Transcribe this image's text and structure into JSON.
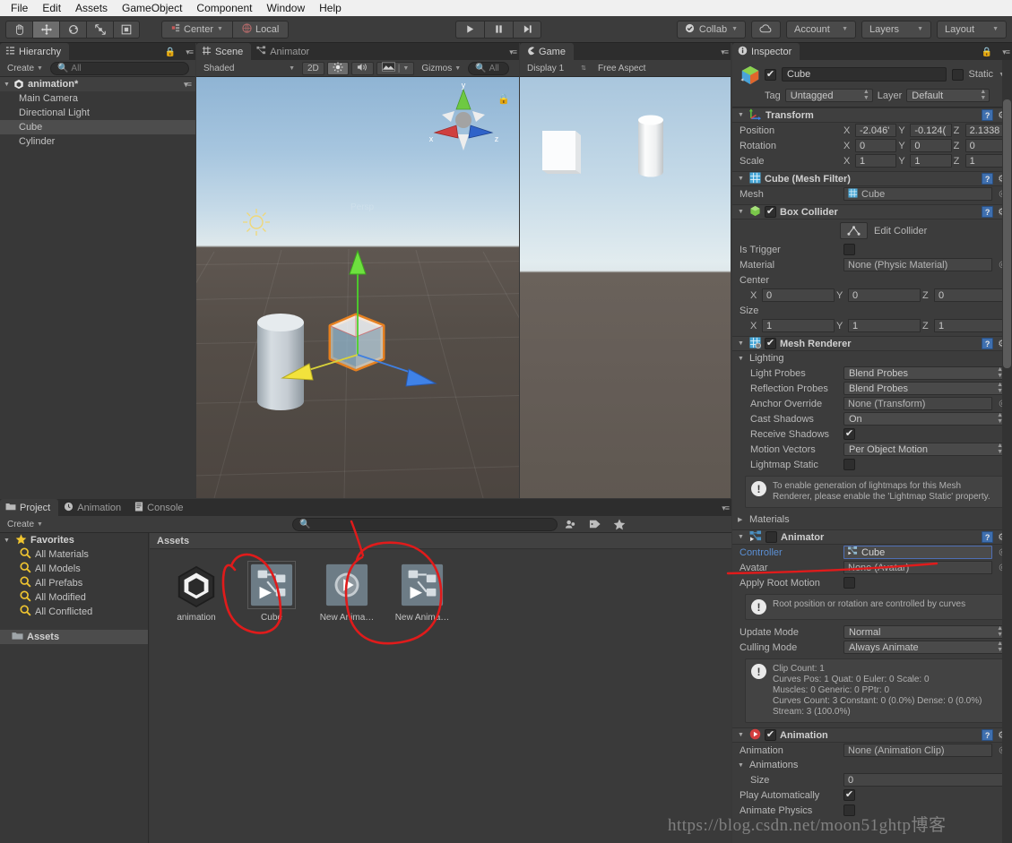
{
  "menubar": {
    "items": [
      "File",
      "Edit",
      "Assets",
      "GameObject",
      "Component",
      "Window",
      "Help"
    ]
  },
  "toolbar": {
    "transform_tools": [
      {
        "name": "hand-tool",
        "glyph": "✋",
        "active": false
      },
      {
        "name": "move-tool",
        "glyph": "✥",
        "active": true
      },
      {
        "name": "rotate-tool",
        "glyph": "↻",
        "active": false
      },
      {
        "name": "scale-tool",
        "glyph": "⤢",
        "active": false
      },
      {
        "name": "rect-tool",
        "glyph": "▣",
        "active": false
      }
    ],
    "pivot_label": "Center",
    "space_label": "Local",
    "play_label": "▶",
    "pause_label": "❚❚",
    "step_label": "▶❘",
    "collab_label": "Collab",
    "cloud_label": "☁",
    "account_label": "Account",
    "layers_label": "Layers",
    "layout_label": "Layout"
  },
  "hierarchy": {
    "tab_label": "Hierarchy",
    "create_label": "Create",
    "search_placeholder": "All",
    "scene_name": "animation*",
    "items": [
      {
        "label": "Main Camera",
        "selected": false
      },
      {
        "label": "Directional Light",
        "selected": false
      },
      {
        "label": "Cube",
        "selected": true
      },
      {
        "label": "Cylinder",
        "selected": false
      }
    ]
  },
  "scene": {
    "tabs": [
      {
        "label": "Scene",
        "active": true
      },
      {
        "label": "Animator",
        "active": false
      }
    ],
    "shading_label": "Shaded",
    "mode_2d_label": "2D",
    "lighting_icon": "sun-icon",
    "audio_icon": "speaker-icon",
    "fx_icon": "image-icon",
    "gizmos_label": "Gizmos",
    "search_placeholder": "All",
    "gizmo_axes": {
      "x": "x",
      "y": "y",
      "z": "z"
    }
  },
  "game": {
    "tab_label": "Game",
    "display_label": "Display 1",
    "aspect_label": "Free Aspect"
  },
  "inspector": {
    "tab_label": "Inspector",
    "object_name": "Cube",
    "object_enabled": true,
    "static_label": "Static",
    "static_checked": false,
    "tag_label": "Tag",
    "tag_value": "Untagged",
    "layer_label": "Layer",
    "layer_value": "Default",
    "transform": {
      "title": "Transform",
      "rows": [
        {
          "label": "Position",
          "x": "-2.046'",
          "y": "-0.124(",
          "z": "2.1338"
        },
        {
          "label": "Rotation",
          "x": "0",
          "y": "0",
          "z": "0"
        },
        {
          "label": "Scale",
          "x": "1",
          "y": "1",
          "z": "1"
        }
      ]
    },
    "mesh_filter": {
      "title": "Cube (Mesh Filter)",
      "mesh_label": "Mesh",
      "mesh_value": "Cube"
    },
    "box_collider": {
      "title": "Box Collider",
      "enabled": true,
      "edit_collider_label": "Edit Collider",
      "is_trigger_label": "Is Trigger",
      "is_trigger_checked": false,
      "material_label": "Material",
      "material_value": "None (Physic Material)",
      "center_label": "Center",
      "center": {
        "x": "0",
        "y": "0",
        "z": "0"
      },
      "size_label": "Size",
      "size": {
        "x": "1",
        "y": "1",
        "z": "1"
      }
    },
    "mesh_renderer": {
      "title": "Mesh Renderer",
      "enabled": true,
      "lighting_label": "Lighting",
      "light_probes_label": "Light Probes",
      "light_probes_value": "Blend Probes",
      "reflection_probes_label": "Reflection Probes",
      "reflection_probes_value": "Blend Probes",
      "anchor_override_label": "Anchor Override",
      "anchor_override_value": "None (Transform)",
      "cast_shadows_label": "Cast Shadows",
      "cast_shadows_value": "On",
      "receive_shadows_label": "Receive Shadows",
      "receive_shadows_checked": true,
      "motion_vectors_label": "Motion Vectors",
      "motion_vectors_value": "Per Object Motion",
      "lightmap_static_label": "Lightmap Static",
      "lightmap_static_checked": false,
      "info_text": "To enable generation of lightmaps for this Mesh Renderer, please enable the 'Lightmap Static' property.",
      "materials_label": "Materials"
    },
    "animator": {
      "title": "Animator",
      "enabled": false,
      "controller_label": "Controller",
      "controller_value": "Cube",
      "avatar_label": "Avatar",
      "avatar_value": "None (Avatar)",
      "apply_root_motion_label": "Apply Root Motion",
      "apply_root_motion_checked": false,
      "root_info_text": "Root position or rotation are controlled by curves",
      "update_mode_label": "Update Mode",
      "update_mode_value": "Normal",
      "culling_mode_label": "Culling Mode",
      "culling_mode_value": "Always Animate",
      "clip_info_text": "Clip Count: 1\nCurves Pos: 1 Quat: 0 Euler: 0 Scale: 0\nMuscles: 0 Generic: 0 PPtr: 0\nCurves Count: 3 Constant: 0 (0.0%) Dense: 0 (0.0%) Stream: 3 (100.0%)"
    },
    "animation": {
      "title": "Animation",
      "enabled": true,
      "animation_label": "Animation",
      "animation_value": "None (Animation Clip)",
      "animations_label": "Animations",
      "size_label": "Size",
      "size_value": "0",
      "play_automatically_label": "Play Automatically",
      "play_automatically_checked": true,
      "animate_physics_label": "Animate Physics"
    }
  },
  "project": {
    "tabs": [
      {
        "label": "Project",
        "active": true
      },
      {
        "label": "Animation",
        "active": false
      },
      {
        "label": "Console",
        "active": false
      }
    ],
    "create_label": "Create",
    "search_placeholder": "",
    "favorites_label": "Favorites",
    "favorites": [
      "All Materials",
      "All Models",
      "All Prefabs",
      "All Modified",
      "All Conflicted"
    ],
    "assets_tree_label": "Assets",
    "assets_header": "Assets",
    "assets": [
      {
        "name": "animation",
        "icon": "unity-scene-icon",
        "selected": false
      },
      {
        "name": "Cube",
        "icon": "animator-controller-icon",
        "selected": true
      },
      {
        "name": "New Anima…",
        "icon": "animation-clip-icon",
        "selected": false
      },
      {
        "name": "New Anima…",
        "icon": "animator-controller-icon",
        "selected": false
      }
    ]
  },
  "annotations": {
    "highlight_color": "#e01b1b",
    "marks": [
      "circle-around-cube-asset",
      "circle-around-new-animator-asset",
      "arrow-to-controller-field"
    ]
  },
  "watermark": "https://blog.csdn.net/moon51ghtp博客"
}
